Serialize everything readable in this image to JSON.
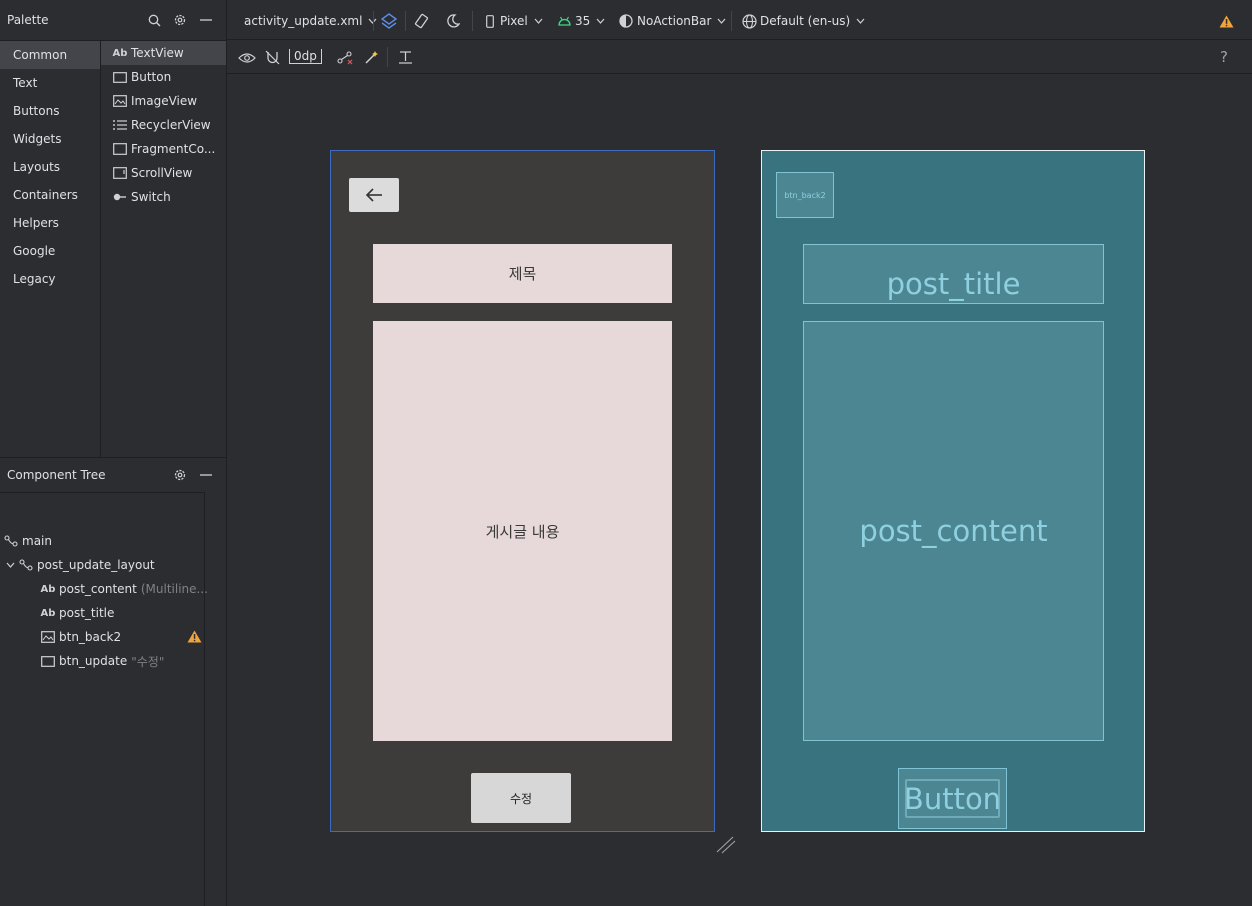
{
  "palette": {
    "title": "Palette",
    "categories": [
      {
        "label": "Common",
        "active": true
      },
      {
        "label": "Text",
        "active": false
      },
      {
        "label": "Buttons",
        "active": false
      },
      {
        "label": "Widgets",
        "active": false
      },
      {
        "label": "Layouts",
        "active": false
      },
      {
        "label": "Containers",
        "active": false
      },
      {
        "label": "Helpers",
        "active": false
      },
      {
        "label": "Google",
        "active": false
      },
      {
        "label": "Legacy",
        "active": false
      }
    ],
    "widgets": [
      {
        "label": "TextView",
        "icon": "textview-icon",
        "icon_text": "Ab"
      },
      {
        "label": "Button",
        "icon": "button-icon",
        "icon_text": ""
      },
      {
        "label": "ImageView",
        "icon": "imageview-icon",
        "icon_text": ""
      },
      {
        "label": "RecyclerView",
        "icon": "recyclerview-icon",
        "icon_text": ""
      },
      {
        "label": "FragmentCo...",
        "icon": "fragment-icon",
        "icon_text": ""
      },
      {
        "label": "ScrollView",
        "icon": "scrollview-icon",
        "icon_text": ""
      },
      {
        "label": "Switch",
        "icon": "switch-icon",
        "icon_text": ""
      }
    ]
  },
  "component_tree": {
    "title": "Component Tree",
    "nodes": [
      {
        "label": "main",
        "extra": "",
        "icon": "constraint-icon"
      },
      {
        "label": "post_update_layout",
        "extra": "",
        "icon": "constraint-icon"
      },
      {
        "label": "post_content",
        "extra": "(Multiline...",
        "icon": "textview-icon",
        "icon_text": "Ab"
      },
      {
        "label": "post_title",
        "extra": "",
        "icon": "textview-icon",
        "icon_text": "Ab"
      },
      {
        "label": "btn_back2",
        "extra": "",
        "icon": "imageview-icon",
        "warning": true
      },
      {
        "label": "btn_update",
        "extra": "\"수정\"",
        "icon": "button-icon"
      }
    ]
  },
  "toolbar": {
    "file": "activity_update.xml",
    "device": "Pixel",
    "api": "35",
    "theme": "NoActionBar",
    "locale": "Default (en-us)",
    "margin": "0dp",
    "help": "?"
  },
  "design": {
    "title_hint": "제목",
    "content_hint": "게시글 내용",
    "update_label": "수정"
  },
  "blueprint": {
    "back_label": "btn_back2",
    "title_label": "post_title",
    "content_label": "post_content",
    "button_label": "Button"
  },
  "colors": {
    "accent": "#3d6bbf",
    "warning": "#f2a33a",
    "blueprint_bg": "#38737f"
  }
}
